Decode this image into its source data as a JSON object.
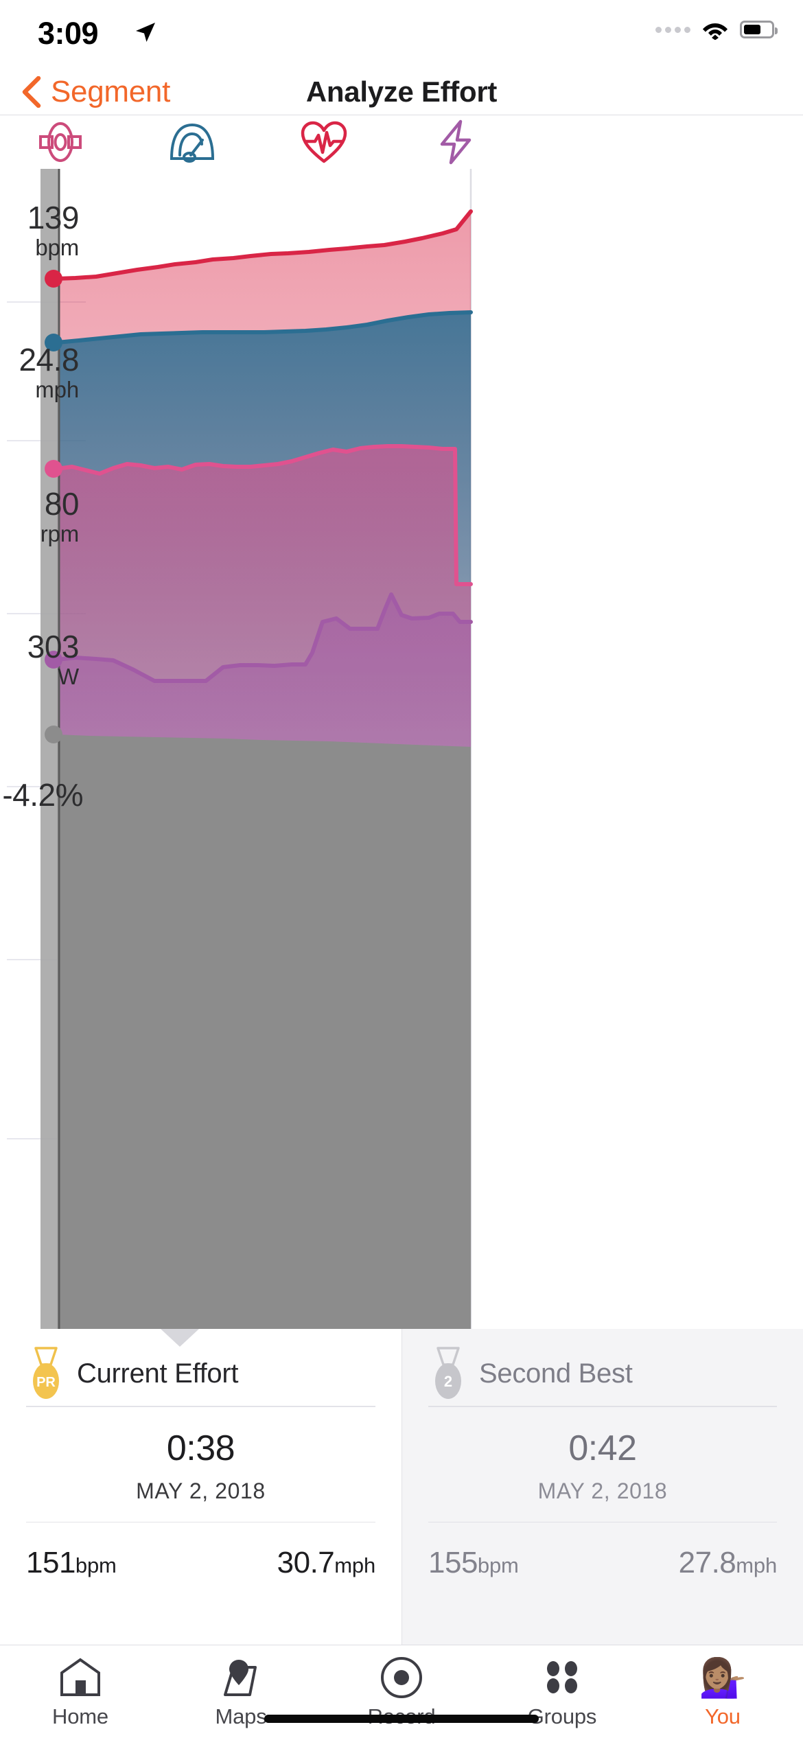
{
  "status_bar": {
    "time": "3:09",
    "location_icon": "location-arrow-icon",
    "signal_icon": "signal-dots-icon",
    "wifi_icon": "wifi-icon",
    "battery_icon": "battery-icon"
  },
  "nav": {
    "back_icon": "chevron-left-icon",
    "back_label": "Segment",
    "title": "Analyze Effort",
    "accent_color": "#f2672a"
  },
  "metric_tabs": [
    {
      "name": "cadence",
      "icon": "crank-arm-icon",
      "color": "#cc4b7b"
    },
    {
      "name": "speed",
      "icon": "speedometer-icon",
      "color": "#2b6e92"
    },
    {
      "name": "heartrate",
      "icon": "heart-pulse-icon",
      "color": "#d92546"
    },
    {
      "name": "power",
      "icon": "lightning-bolt-icon",
      "color": "#a25ba6"
    }
  ],
  "chart_data": {
    "type": "area",
    "title": "Analyze Effort",
    "xlabel": "",
    "ylabel": "",
    "grid": true,
    "legend": "none",
    "scrubber": {
      "position_pct": 2.4,
      "label": "effort-scrubber"
    },
    "axis_labels": [
      {
        "value": "139",
        "unit": "bpm",
        "metric": "heartrate",
        "color": "#d92546"
      },
      {
        "value": "24.8",
        "unit": "mph",
        "metric": "speed",
        "color": "#2b6e92"
      },
      {
        "value": "80",
        "unit": "rpm",
        "metric": "cadence",
        "color": "#e0528f"
      },
      {
        "value": "303",
        "unit": "W",
        "metric": "power",
        "color": "#a25ba6"
      },
      {
        "value": "-4.2%",
        "unit": "",
        "metric": "grade",
        "color": "#808080"
      }
    ],
    "series": [
      {
        "name": "Heart Rate",
        "unit": "bpm",
        "color": "#d92546",
        "values": [
          127,
          127,
          127,
          128,
          129,
          129,
          130,
          130,
          131,
          131,
          132,
          132,
          132,
          133,
          133,
          133,
          133,
          134,
          134,
          134,
          134,
          135,
          135,
          135,
          135,
          135,
          136,
          136,
          136,
          136,
          136,
          137,
          137,
          137,
          137,
          138,
          138,
          138,
          138,
          139,
          139,
          139,
          139,
          140,
          140,
          141,
          141,
          142,
          142,
          143,
          144,
          145
        ]
      },
      {
        "name": "Speed",
        "unit": "mph",
        "color": "#2b6e92",
        "values": [
          24.6,
          24.7,
          24.8,
          24.9,
          25.0,
          25.1,
          25.2,
          25.2,
          25.3,
          25.3,
          25.4,
          25.4,
          25.5,
          25.5,
          25.5,
          25.5,
          25.5,
          25.6,
          25.6,
          25.6,
          25.6,
          25.6,
          25.6,
          25.6,
          25.7,
          25.7,
          25.7,
          25.7,
          25.8,
          25.8,
          25.8,
          25.8,
          25.9,
          25.9,
          26.0,
          26.0,
          26.1,
          26.2,
          26.3,
          26.4,
          26.5,
          26.6,
          26.7,
          26.8,
          26.9,
          27.0,
          27.0,
          27.1,
          27.1,
          27.1,
          27.1,
          27.1
        ]
      },
      {
        "name": "Cadence",
        "unit": "rpm",
        "color": "#e0528f",
        "values": [
          80,
          80,
          79,
          80,
          81,
          80,
          79,
          81,
          81,
          81,
          80,
          79,
          80,
          81,
          81,
          81,
          80,
          80,
          80,
          81,
          81,
          82,
          81,
          80,
          80,
          81,
          82,
          83,
          84,
          84,
          85,
          86,
          87,
          87,
          86,
          85,
          85,
          85,
          86,
          87,
          87,
          87,
          86,
          0,
          0,
          0,
          0,
          0,
          0,
          0,
          0,
          0
        ]
      },
      {
        "name": "Power",
        "unit": "W",
        "color": "#a25ba6",
        "values": [
          303,
          304,
          305,
          306,
          306,
          304,
          300,
          296,
          292,
          289,
          288,
          286,
          286,
          270,
          262,
          262,
          262,
          262,
          276,
          278,
          278,
          279,
          281,
          282,
          281,
          280,
          282,
          340,
          352,
          330,
          330,
          362,
          362,
          362,
          362,
          388,
          350,
          350,
          352,
          358,
          358,
          340,
          340,
          338,
          338,
          338,
          338,
          338,
          338,
          338,
          338,
          338
        ]
      },
      {
        "name": "Grade",
        "unit": "%",
        "color": "#808080",
        "values": [
          -4.2,
          -4.2,
          -4.2,
          -4.2,
          -4.2,
          -4.2,
          -4.2,
          -4.2,
          -4.2,
          -4.2,
          -4.1,
          -4.1,
          -4.1,
          -4.1,
          -4.1,
          -4.1,
          -4.1,
          -4.1,
          -4.2,
          -4.2,
          -4.2,
          -4.2,
          -4.2,
          -4.2,
          -4.2,
          -4.2,
          -4.2,
          -4.2,
          -4.2,
          -4.2,
          -4.3,
          -4.3,
          -4.3,
          -4.3,
          -4.3,
          -4.3,
          -4.4,
          -4.4,
          -4.4,
          -4.4,
          -4.5,
          -4.5,
          -4.5,
          -4.5,
          -4.5,
          -4.5,
          -4.5,
          -4.6,
          -4.6,
          -4.6,
          -4.6,
          -4.6
        ]
      }
    ]
  },
  "comparison": {
    "current": {
      "badge": "PR",
      "badge_type": "pr-medal-icon",
      "label": "Current Effort",
      "time": "0:38",
      "date": "MAY 2, 2018",
      "stats": [
        {
          "value": "151",
          "unit": "bpm"
        },
        {
          "value": "30.7",
          "unit": "mph"
        }
      ]
    },
    "second": {
      "badge": "2",
      "badge_type": "rank-medal-icon",
      "label": "Second Best",
      "time": "0:42",
      "date": "MAY 2, 2018",
      "stats": [
        {
          "value": "155",
          "unit": "bpm"
        },
        {
          "value": "27.8",
          "unit": "mph"
        }
      ]
    }
  },
  "tabbar": {
    "active": "You",
    "items": [
      {
        "label": "Home",
        "icon": "home-icon"
      },
      {
        "label": "Maps",
        "icon": "map-pin-icon"
      },
      {
        "label": "Record",
        "icon": "record-circle-icon"
      },
      {
        "label": "Groups",
        "icon": "groups-dots-icon"
      },
      {
        "label": "You",
        "icon": "avatar-icon",
        "avatar": "💁🏽‍♀️"
      }
    ]
  }
}
